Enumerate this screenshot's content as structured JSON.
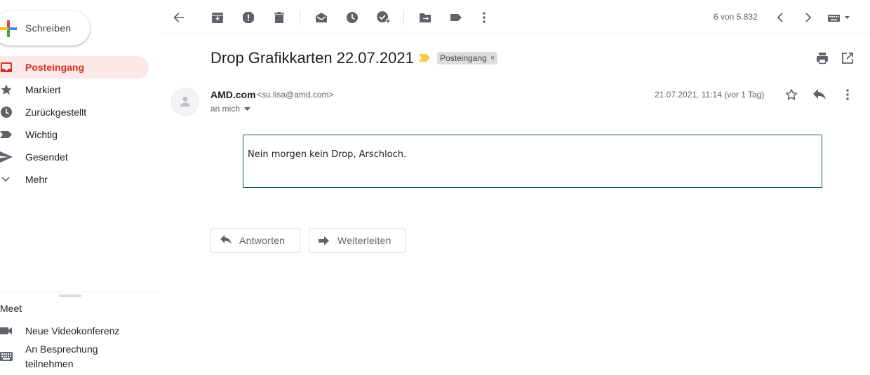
{
  "compose": {
    "label": "Schreiben"
  },
  "nav": [
    {
      "label": "Posteingang",
      "icon": "inbox-icon",
      "active": true
    },
    {
      "label": "Markiert",
      "icon": "star-icon"
    },
    {
      "label": "Zurückgestellt",
      "icon": "clock-icon"
    },
    {
      "label": "Wichtig",
      "icon": "important-icon"
    },
    {
      "label": "Gesendet",
      "icon": "send-icon"
    },
    {
      "label": "Mehr",
      "icon": "chevron-down-icon"
    }
  ],
  "meet": {
    "title": "Meet",
    "new_meeting": "Neue Videokonferenz",
    "join_line1": "An Besprechung",
    "join_line2": "teilnehmen"
  },
  "toolbar": {
    "pager": "6 von 5.832"
  },
  "message": {
    "subject": "Drop Grafikkarten 22.07.2021",
    "label_chip": "Posteingang",
    "label_close": "×",
    "sender_name": "AMD.com",
    "sender_email": "<su.lisa@amd.com>",
    "to": "an mich",
    "date": "21.07.2021, 11:14 (vor 1 Tag)",
    "body": "Nein morgen kein Drop, Arschloch."
  },
  "actions": {
    "reply": "Antworten",
    "forward": "Weiterleiten"
  },
  "colors": {
    "accent_red": "#d93025",
    "active_bg": "#fce8e6",
    "icon_gray": "#5f6368",
    "important_yellow": "#f4cb45",
    "body_border": "#13616a"
  }
}
